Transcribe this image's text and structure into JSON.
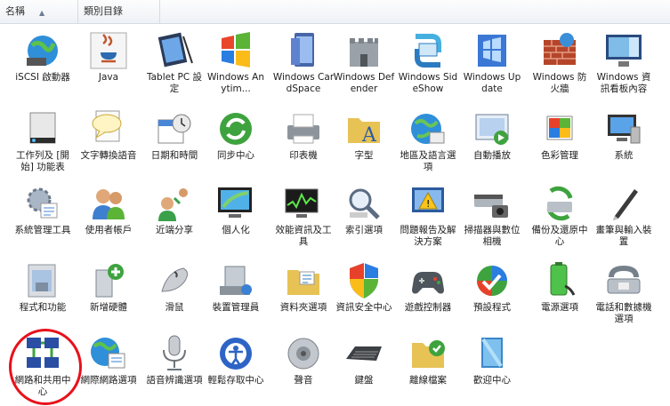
{
  "header": {
    "name_col": "名稱",
    "category_col": "類別目錄"
  },
  "items": [
    {
      "label": "iSCSI 啟動器",
      "icon": "iscsi-globe-icon"
    },
    {
      "label": "Java",
      "icon": "java-icon"
    },
    {
      "label": "Tablet PC 設定",
      "icon": "tablet-pc-icon"
    },
    {
      "label": "Windows Anytim...",
      "icon": "windows-anytime-icon"
    },
    {
      "label": "Windows CardSpace",
      "icon": "cardspace-icon"
    },
    {
      "label": "Windows Defender",
      "icon": "defender-castle-icon"
    },
    {
      "label": "Windows SideShow",
      "icon": "sideshow-icon"
    },
    {
      "label": "Windows Update",
      "icon": "windows-update-icon"
    },
    {
      "label": "Windows 防火牆",
      "icon": "firewall-brick-icon"
    },
    {
      "label": "Windows 資訊看板內容",
      "icon": "sidebar-gadgets-icon"
    },
    {
      "label": "工作列及 [開始] 功能表",
      "icon": "taskbar-icon"
    },
    {
      "label": "文字轉換語音",
      "icon": "speech-bubble-icon"
    },
    {
      "label": "日期和時間",
      "icon": "calendar-clock-icon"
    },
    {
      "label": "同步中心",
      "icon": "sync-center-icon"
    },
    {
      "label": "印表機",
      "icon": "printer-icon"
    },
    {
      "label": "字型",
      "icon": "fonts-folder-icon"
    },
    {
      "label": "地區及語言選項",
      "icon": "region-globe-icon"
    },
    {
      "label": "自動播放",
      "icon": "autoplay-icon"
    },
    {
      "label": "色彩管理",
      "icon": "color-management-icon"
    },
    {
      "label": "系統",
      "icon": "system-monitor-icon"
    },
    {
      "label": "系統管理工具",
      "icon": "admin-tools-icon"
    },
    {
      "label": "使用者帳戶",
      "icon": "user-accounts-icon"
    },
    {
      "label": "近端分享",
      "icon": "people-near-me-icon"
    },
    {
      "label": "個人化",
      "icon": "personalization-icon"
    },
    {
      "label": "效能資訊及工具",
      "icon": "performance-icon"
    },
    {
      "label": "索引選項",
      "icon": "indexing-icon"
    },
    {
      "label": "問題報告及解決方案",
      "icon": "problem-reports-icon"
    },
    {
      "label": "掃描器與數位相機",
      "icon": "scanner-camera-icon"
    },
    {
      "label": "備份及還原中心",
      "icon": "backup-restore-icon"
    },
    {
      "label": "畫筆與輸入裝置",
      "icon": "pen-input-icon"
    },
    {
      "label": "程式和功能",
      "icon": "programs-features-icon"
    },
    {
      "label": "新增硬體",
      "icon": "add-hardware-icon"
    },
    {
      "label": "滑鼠",
      "icon": "mouse-icon"
    },
    {
      "label": "裝置管理員",
      "icon": "device-manager-icon"
    },
    {
      "label": "資料夾選項",
      "icon": "folder-options-icon"
    },
    {
      "label": "資訊安全中心",
      "icon": "security-shield-icon"
    },
    {
      "label": "遊戲控制器",
      "icon": "game-controller-icon"
    },
    {
      "label": "預設程式",
      "icon": "default-programs-icon"
    },
    {
      "label": "電源選項",
      "icon": "power-options-icon"
    },
    {
      "label": "電話和數據機選項",
      "icon": "phone-modem-icon"
    },
    {
      "label": "網路和共用中心",
      "icon": "network-sharing-icon"
    },
    {
      "label": "網際網路選項",
      "icon": "internet-options-icon"
    },
    {
      "label": "語音辨識選項",
      "icon": "microphone-icon"
    },
    {
      "label": "輕鬆存取中心",
      "icon": "ease-of-access-icon"
    },
    {
      "label": "聲音",
      "icon": "speaker-icon"
    },
    {
      "label": "鍵盤",
      "icon": "keyboard-icon"
    },
    {
      "label": "離線檔案",
      "icon": "offline-files-icon"
    },
    {
      "label": "歡迎中心",
      "icon": "welcome-center-icon"
    }
  ],
  "colors": {
    "highlight_circle": "#e8101a",
    "header_border": "#d5dbe5"
  }
}
